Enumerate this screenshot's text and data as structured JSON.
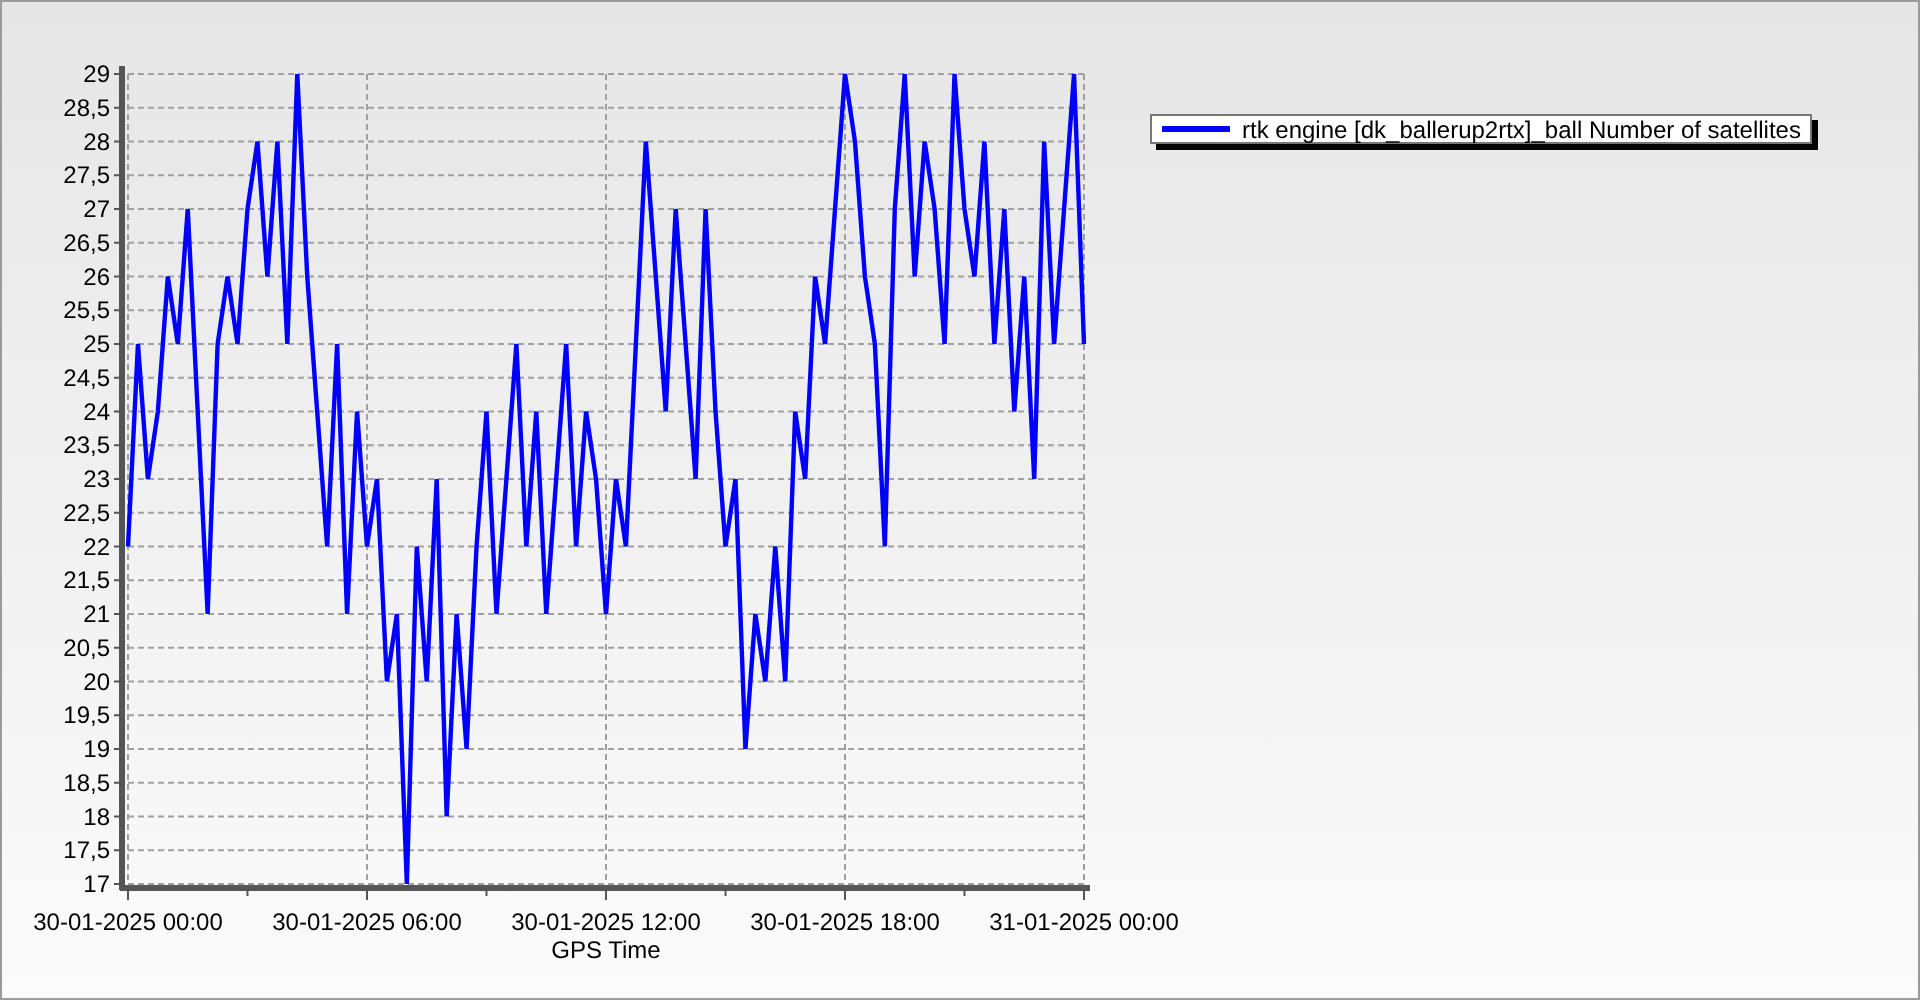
{
  "chart": {
    "chart_data": {
      "type": "line",
      "grid": true,
      "xlabel": "GPS Time",
      "categories": [
        "30-01-2025 00:00",
        null,
        null,
        null,
        null,
        null,
        null,
        null,
        null,
        null,
        null,
        null,
        null,
        null,
        null,
        null,
        null,
        null,
        null,
        null,
        null,
        null,
        null,
        null,
        "30-01-2025 06:00",
        null,
        null,
        null,
        null,
        null,
        null,
        null,
        null,
        null,
        null,
        null,
        null,
        null,
        null,
        null,
        null,
        null,
        null,
        null,
        null,
        null,
        null,
        null,
        "30-01-2025 12:00",
        null,
        null,
        null,
        null,
        null,
        null,
        null,
        null,
        null,
        null,
        null,
        null,
        null,
        null,
        null,
        null,
        null,
        null,
        null,
        null,
        null,
        null,
        null,
        "30-01-2025 18:00",
        null,
        null,
        null,
        null,
        null,
        null,
        null,
        null,
        null,
        null,
        null,
        null,
        null,
        null,
        null,
        null,
        null,
        null,
        null,
        null,
        null,
        null,
        null,
        "31-01-2025 00:00"
      ],
      "series": [
        {
          "name": "rtk engine [dk_ballerup2rtx]_ball Number of satellites",
          "color": "#0000ff",
          "values": [
            22,
            25,
            23,
            24,
            26,
            25,
            27,
            24,
            21,
            25,
            26,
            25,
            27,
            28,
            26,
            28,
            25,
            29,
            26,
            24,
            22,
            25,
            21,
            24,
            22,
            23,
            20,
            21,
            17,
            22,
            20,
            23,
            18,
            21,
            19,
            22,
            24,
            21,
            23,
            25,
            22,
            24,
            21,
            23,
            25,
            22,
            24,
            23,
            21,
            23,
            22,
            25,
            28,
            26,
            24,
            27,
            25,
            23,
            27,
            24,
            22,
            23,
            19,
            21,
            20,
            22,
            20,
            24,
            23,
            26,
            25,
            27,
            29,
            28,
            26,
            25,
            22,
            27,
            29,
            26,
            28,
            27,
            25,
            29,
            27,
            26,
            28,
            25,
            27,
            24,
            26,
            23,
            28,
            25,
            27,
            29,
            25
          ]
        }
      ],
      "ylim": [
        17,
        29
      ],
      "yticks": [
        {
          "value": 17,
          "label": "17"
        },
        {
          "value": 17.5,
          "label": "17,5"
        },
        {
          "value": 18,
          "label": "18"
        },
        {
          "value": 18.5,
          "label": "18,5"
        },
        {
          "value": 19,
          "label": "19"
        },
        {
          "value": 19.5,
          "label": "19,5"
        },
        {
          "value": 20,
          "label": "20"
        },
        {
          "value": 20.5,
          "label": "20,5"
        },
        {
          "value": 21,
          "label": "21"
        },
        {
          "value": 21.5,
          "label": "21,5"
        },
        {
          "value": 22,
          "label": "22"
        },
        {
          "value": 22.5,
          "label": "22,5"
        },
        {
          "value": 23,
          "label": "23"
        },
        {
          "value": 23.5,
          "label": "23,5"
        },
        {
          "value": 24,
          "label": "24"
        },
        {
          "value": 24.5,
          "label": "24,5"
        },
        {
          "value": 25,
          "label": "25"
        },
        {
          "value": 25.5,
          "label": "25,5"
        },
        {
          "value": 26,
          "label": "26"
        },
        {
          "value": 26.5,
          "label": "26,5"
        },
        {
          "value": 27,
          "label": "27"
        },
        {
          "value": 27.5,
          "label": "27,5"
        },
        {
          "value": 28,
          "label": "28"
        },
        {
          "value": 28.5,
          "label": "28,5"
        },
        {
          "value": 29,
          "label": "29"
        }
      ]
    }
  }
}
